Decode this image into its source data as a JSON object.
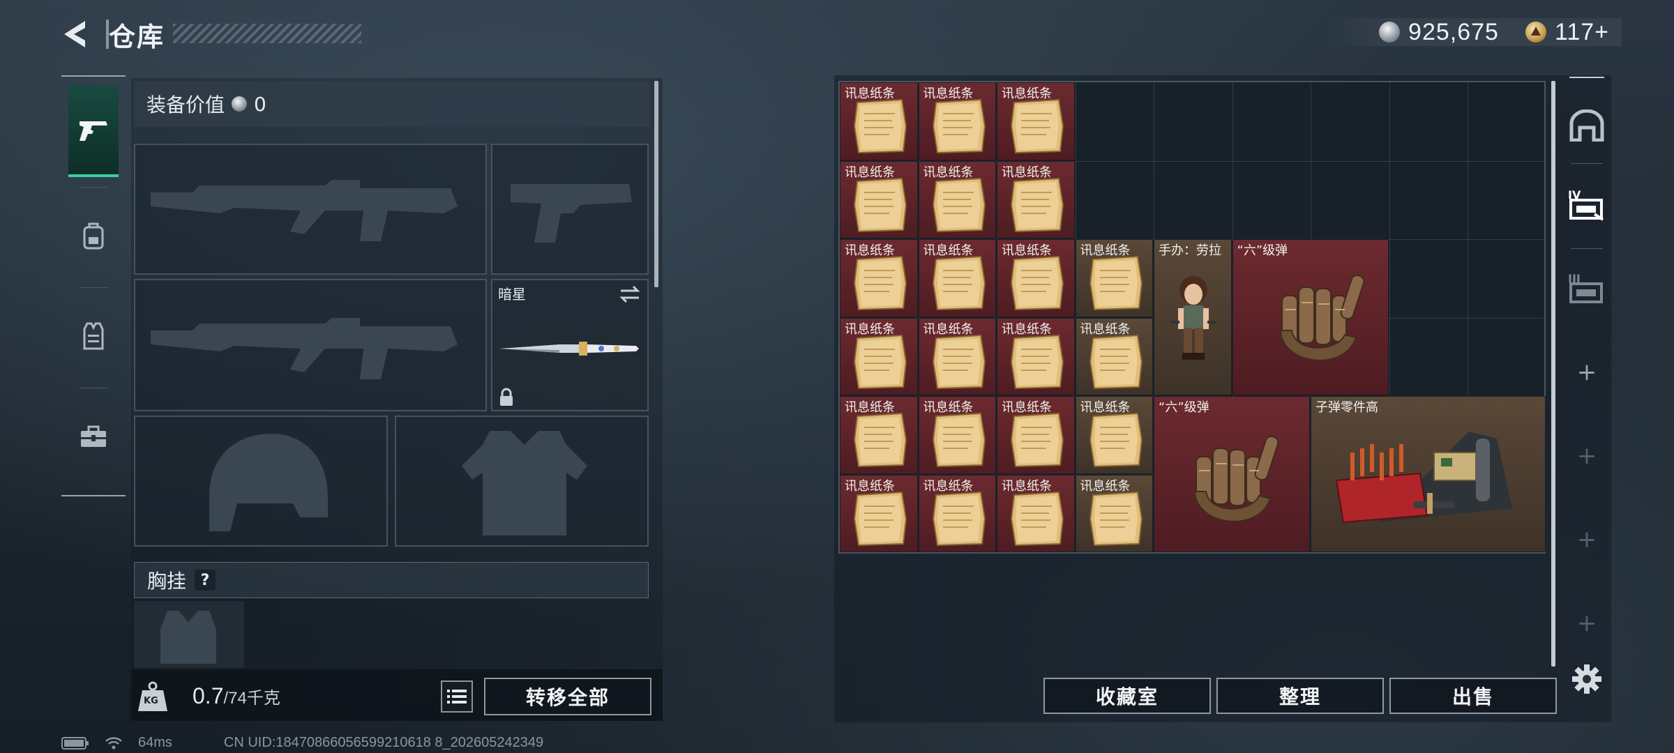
{
  "header": {
    "title": "仓库",
    "currencies": [
      {
        "icon": "silver-coin-icon",
        "value": "925,675"
      },
      {
        "icon": "gold-token-icon",
        "value": "117+"
      }
    ]
  },
  "left_rail": {
    "tabs": [
      {
        "icon": "pistol-icon",
        "active": true
      },
      {
        "icon": "backpack-icon",
        "active": false
      },
      {
        "icon": "vest-icon",
        "active": false
      },
      {
        "icon": "toolbox-icon",
        "active": false
      }
    ]
  },
  "loadout": {
    "equip_value_label": "装备价值",
    "equip_value": "0",
    "melee_name": "暗星",
    "chest_rig_label": "胸挂",
    "help_glyph": "?",
    "weight_value": "0.7",
    "weight_max": "/74千克",
    "weight_icon_text": "KG",
    "transfer_all_label": "转移全部"
  },
  "stash": {
    "items": [
      {
        "name": "讯息纸条",
        "bg": "red"
      },
      {
        "name": "手办：劳拉",
        "bg": "brown"
      },
      {
        "name": "“六”级弹",
        "bg": "red"
      },
      {
        "name": "子弹零件高",
        "bg": "brown"
      }
    ],
    "buttons": {
      "collection": "收藏室",
      "organize": "整理",
      "sell": "出售"
    }
  },
  "status_bar": {
    "latency": "64ms",
    "uid": "CN UID:18470866056599210618 8_202605242349"
  }
}
